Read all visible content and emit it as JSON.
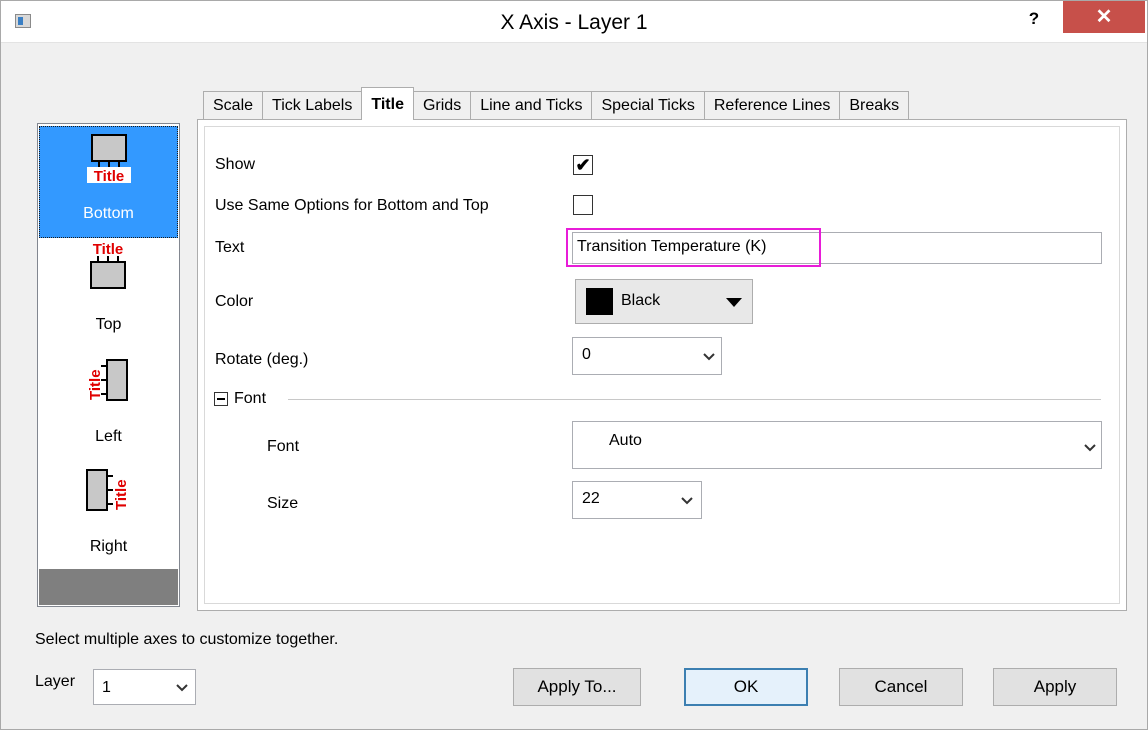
{
  "window": {
    "title": "X Axis - Layer 1",
    "help_label": "?",
    "close_label": "✕"
  },
  "axis_list": {
    "items": [
      {
        "label": "Bottom",
        "icon_text": "Title",
        "selected": true
      },
      {
        "label": "Top",
        "icon_text": "Title",
        "selected": false
      },
      {
        "label": "Left",
        "icon_text": "Title",
        "selected": false
      },
      {
        "label": "Right",
        "icon_text": "Title",
        "selected": false
      }
    ]
  },
  "tabs": [
    {
      "label": "Scale",
      "active": false
    },
    {
      "label": "Tick Labels",
      "active": false
    },
    {
      "label": "Title",
      "active": true
    },
    {
      "label": "Grids",
      "active": false
    },
    {
      "label": "Line and Ticks",
      "active": false
    },
    {
      "label": "Special Ticks",
      "active": false
    },
    {
      "label": "Reference Lines",
      "active": false
    },
    {
      "label": "Breaks",
      "active": false
    }
  ],
  "form": {
    "show_label": "Show",
    "show_checked": true,
    "same_options_label": "Use Same Options for Bottom and Top",
    "same_options_checked": false,
    "text_label": "Text",
    "text_value": "Transition Temperature (K)",
    "color_label": "Color",
    "color_value": "Black",
    "color_hex": "#000000",
    "rotate_label": "Rotate (deg.)",
    "rotate_value": "0",
    "font_group_label": "Font",
    "font_label": "Font",
    "font_value": "Auto",
    "size_label": "Size",
    "size_value": "22"
  },
  "status": "Select multiple axes to customize together.",
  "layer": {
    "label": "Layer",
    "value": "1"
  },
  "buttons": {
    "apply_to": "Apply To...",
    "ok": "OK",
    "cancel": "Cancel",
    "apply": "Apply"
  },
  "colors": {
    "accent": "#3399ff",
    "close": "#c7504a",
    "highlight": "#e81cd8",
    "title_icon_red": "#e00000"
  }
}
